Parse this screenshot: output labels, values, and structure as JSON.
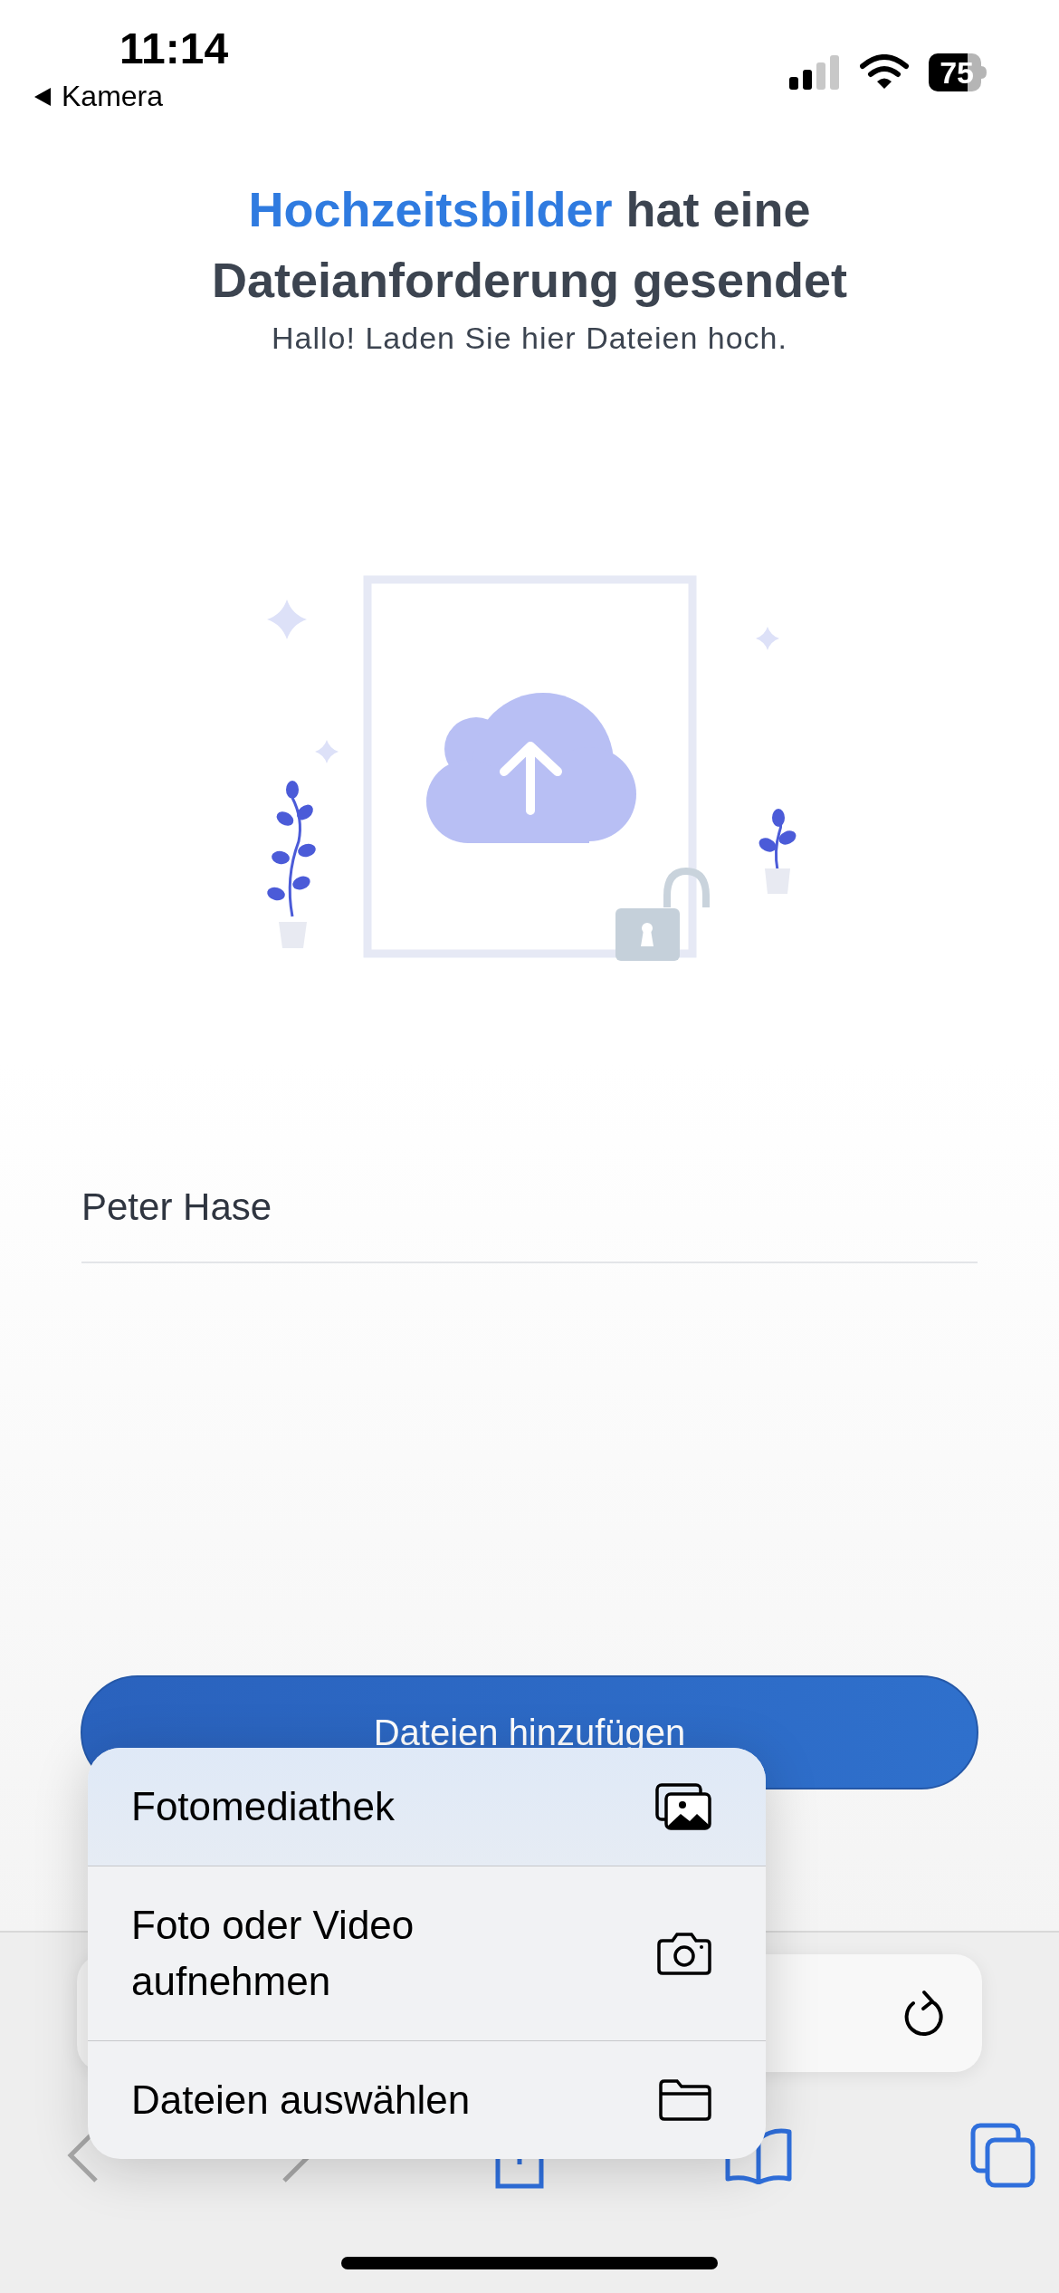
{
  "status_bar": {
    "time": "11:14",
    "back_link": "Kamera",
    "battery": "75"
  },
  "header": {
    "sender": "Hochzeitsbilder",
    "title_rest": "hat eine Dateianforderung gesendet",
    "message": "Hallo! Laden Sie hier Dateien hoch."
  },
  "name_field": {
    "value": "Peter Hase"
  },
  "upload_button": {
    "label": "Dateien hinzufügen"
  },
  "menu": {
    "items": [
      {
        "label": "Fotomediathek",
        "selected": true
      },
      {
        "label": "Foto oder Video aufnehmen",
        "selected": false
      },
      {
        "label": "Dateien auswählen",
        "selected": false
      }
    ]
  }
}
